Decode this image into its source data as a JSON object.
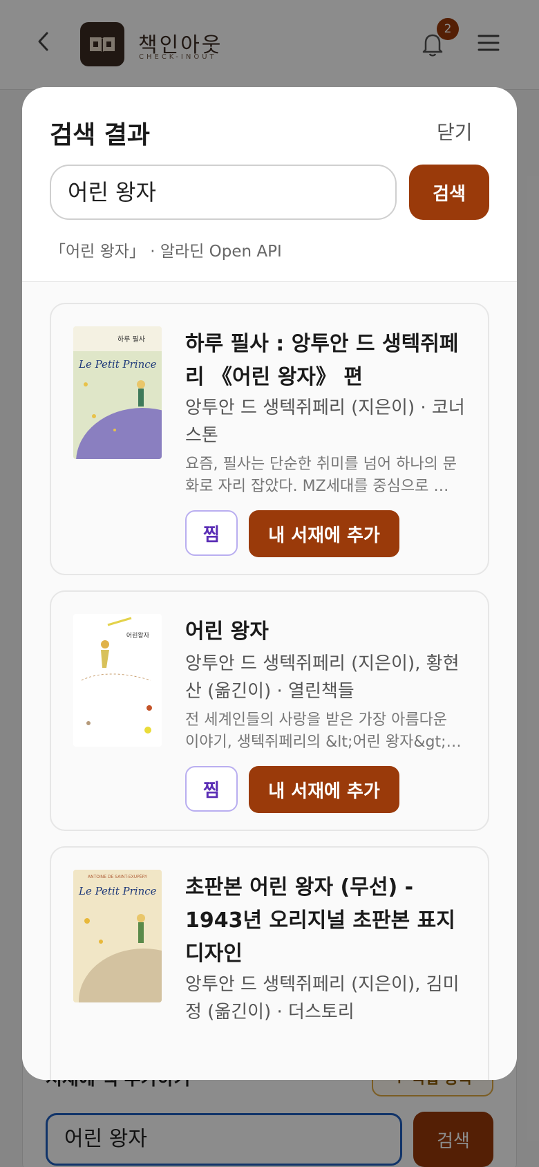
{
  "header": {
    "logo_title": "책인아웃",
    "logo_subtitle": "CHECK-INOUT",
    "notification_count": "2"
  },
  "background_panel": {
    "title": "서재에 책 추가하기",
    "direct_add_label": "+ 직접 등록",
    "search_value": "어린 왕자",
    "search_label": "검색"
  },
  "modal": {
    "title": "검색 결과",
    "close_label": "닫기",
    "search_value": "어린 왕자",
    "search_label": "검색",
    "source_line": "「어린 왕자」 · 알라딘 Open API"
  },
  "results": [
    {
      "title": "하루 필사 : 앙투안 드 생텍쥐페리 《어린 왕자》 편",
      "author": "앙투안 드 생텍쥐페리 (지은이) · 코너스톤",
      "description": "요즘, 필사는 단순한 취미를 넘어 하나의 문화로 자리 잡았다. MZ세대를 중심으로 필사가 유행하면서",
      "like_label": "찜",
      "add_label": "내 서재에 추가",
      "cover_text": "하루 필사",
      "cover_script": "Le Petit Prince"
    },
    {
      "title": "어린 왕자",
      "author": "앙투안 드 생텍쥐페리 (지은이), 황현산 (옮긴이) · 열린책들",
      "description": "전 세계인들의 사랑을 받은 가장 아름다운 이야기, 생텍쥐페리의 &lt;어린 왕자&gt; 세계 문학",
      "like_label": "찜",
      "add_label": "내 서재에 추가",
      "cover_text": "어린왕자"
    },
    {
      "title": "초판본 어린 왕자 (무선) - 1943년 오리지널 초판본 표지디자인",
      "author": "앙투안 드 생텍쥐페리 (지은이), 김미정 (옮긴이) · 더스토리",
      "cover_text": "ANTOINE DE SAINT-EXUPÉRY",
      "cover_script": "Le Petit Prince"
    }
  ]
}
